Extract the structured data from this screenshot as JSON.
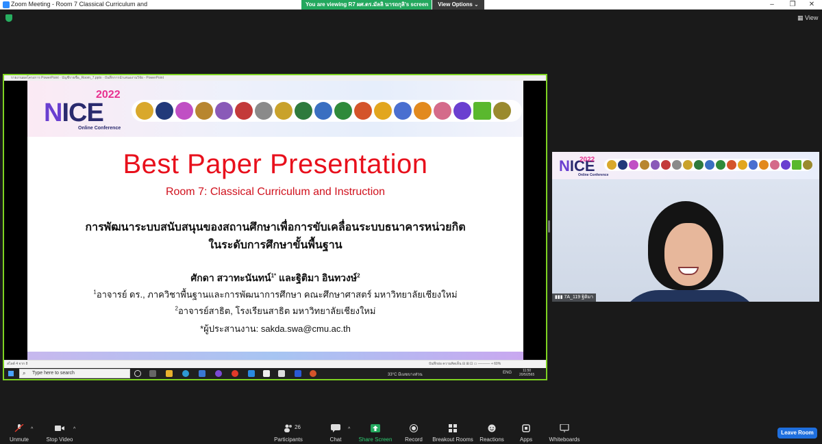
{
  "window": {
    "title": "Zoom Meeting - Room 7 Classical Curriculum and",
    "minimize": "–",
    "restore": "❐",
    "close": "✕"
  },
  "banner": {
    "viewing_text": "You are viewing R7 ผศ.ดร.มัลลิ นารถกุลิ's screen",
    "view_options": "View Options ⌄"
  },
  "view_button": "View",
  "ppt": {
    "titlebar": "รายงานผลโครงการ PowerPoint  ·  บัญชีรายชื่อ_Room_7.pptx  ·  บันทึกการนำเสนองานวิจัย - PowerPoint",
    "status_left": "สไลด์ 4 จาก 8",
    "status_right": "บันทึกย่อ   ความคิดเห็น   ⊟  ⊞  ⊡  ▭   ─────  +  60%"
  },
  "slide": {
    "logo_year": "2022",
    "logo_n": "N",
    "logo_rest": "ICE",
    "logo_sub": "Online Conference",
    "title": "Best Paper Presentation",
    "subtitle": "Room 7: Classical Curriculum and Instruction",
    "thai_line1": "การพัฒนาระบบสนับสนุนของสถานศึกษาเพื่อการขับเคลื่อนระบบธนาคารหน่วยกิต",
    "thai_line2": "ในระดับการศึกษาขั้นพื้นฐาน",
    "author1": "ศักดา สวาทะนันทน์",
    "author1_sup": "1*",
    "author_and": " และฐิติมา อินทวงษ์",
    "author2_sup": "2",
    "aff1_sup": "1",
    "aff1": "อาจารย์ ดร., ภาควิชาพื้นฐานและการพัฒนาการศึกษา คณะศึกษาศาสตร์ มหาวิทยาลัยเชียงใหม่",
    "aff2_sup": "2",
    "aff2": "อาจารย์สาธิต, โรงเรียนสาธิต มหาวิทยาลัยเชียงใหม่",
    "contact": "*ผู้ประสานงาน: sakda.swa@cmu.ac.th"
  },
  "taskbar": {
    "search_placeholder": "Type here to search",
    "weather": "33°C  มีเมฆบางส่วน",
    "lang": "ENG",
    "time": "11:50",
    "date": "20/5/2565"
  },
  "video": {
    "name_label": "7A_119 ฐิติมา",
    "logo_year": "2022",
    "logo_n": "N",
    "logo_rest": "ICE",
    "logo_sub": "Online Conference"
  },
  "toolbar": {
    "unmute": "Unmute",
    "stop_video": "Stop Video",
    "participants": "Participants",
    "participants_count": "26",
    "chat": "Chat",
    "share_screen": "Share Screen",
    "record": "Record",
    "breakout_rooms": "Breakout Rooms",
    "reactions": "Reactions",
    "apps": "Apps",
    "whiteboards": "Whiteboards",
    "leave": "Leave Room"
  },
  "colors": {
    "zoom_blue": "#1f6fde",
    "share_green": "#23a85e",
    "slide_title_red": "#e8101c",
    "frame_green": "#7ed321"
  }
}
